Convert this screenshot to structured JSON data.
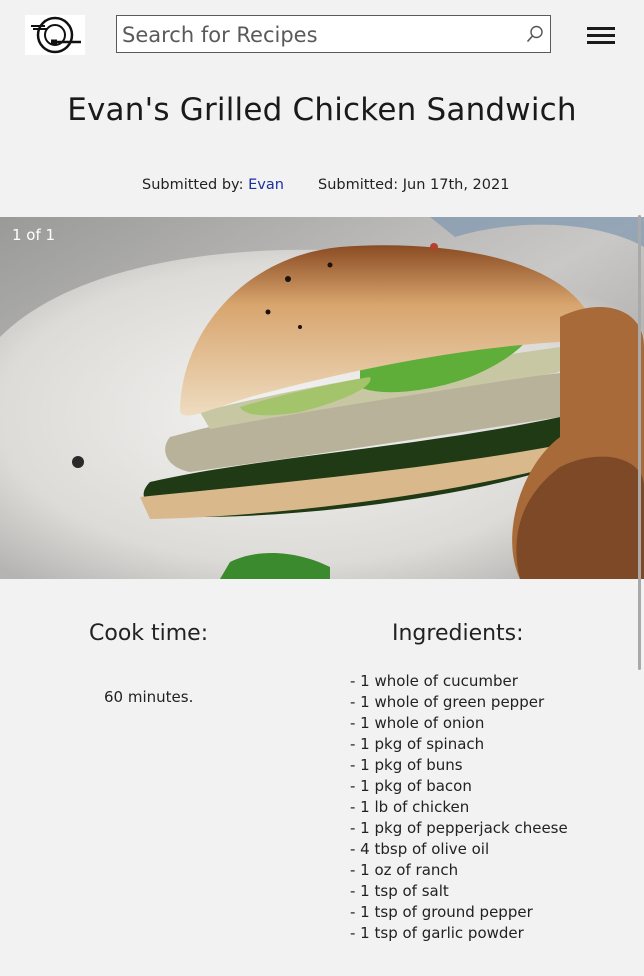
{
  "search": {
    "placeholder": "Search for Recipes"
  },
  "recipe": {
    "title": "Evan's Grilled Chicken Sandwich",
    "submitted_by_label": "Submitted by: ",
    "submitted_by": "Evan",
    "submitted_on": "Submitted: Jun 17th, 2021"
  },
  "gallery": {
    "counter": "1 of 1"
  },
  "cook_time": {
    "heading": "Cook time:",
    "value": "60 minutes."
  },
  "ingredients": {
    "heading": "Ingredients:",
    "items": [
      "- 1 whole of cucumber",
      "- 1 whole of green pepper",
      "- 1 whole of onion",
      "- 1 pkg of spinach",
      "- 1 pkg of buns",
      "- 1 pkg of bacon",
      "- 1 lb of chicken",
      "- 1 pkg of pepperjack cheese",
      "- 4 tbsp of olive oil",
      "- 1 oz of ranch",
      "- 1 tsp of salt",
      "- 1 tsp of ground pepper",
      "- 1 tsp of garlic powder"
    ]
  },
  "icons": {
    "logo": "plate-fork-logo-icon",
    "search": "search-icon",
    "menu": "hamburger-menu-icon"
  }
}
